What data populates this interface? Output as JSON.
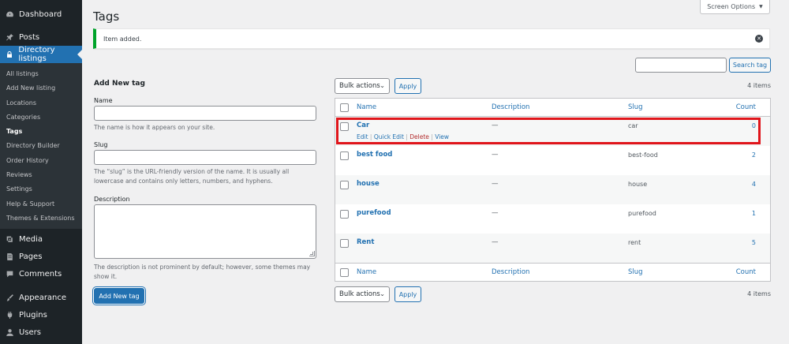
{
  "sidebar": {
    "top_items": [
      {
        "label": "Dashboard",
        "icon": "dashboard-icon"
      },
      {
        "label": "Posts",
        "icon": "pin-icon"
      },
      {
        "label": "Directory listings",
        "icon": "lock-icon"
      }
    ],
    "submenu": [
      "All listings",
      "Add New listing",
      "Locations",
      "Categories",
      "Tags",
      "Directory Builder",
      "Order History",
      "Reviews",
      "Settings",
      "Help & Support",
      "Themes & Extensions"
    ],
    "bottom_items": [
      {
        "label": "Media",
        "icon": "media-icon"
      },
      {
        "label": "Pages",
        "icon": "pages-icon"
      },
      {
        "label": "Comments",
        "icon": "comment-icon"
      },
      {
        "label": "Appearance",
        "icon": "brush-icon"
      },
      {
        "label": "Plugins",
        "icon": "plug-icon"
      },
      {
        "label": "Users",
        "icon": "user-icon"
      }
    ],
    "active_top": "Directory listings",
    "active_sub": "Tags"
  },
  "page": {
    "title": "Tags",
    "screen_options": "Screen Options"
  },
  "notice": {
    "text": "Item added."
  },
  "search": {
    "value": "",
    "button": "Search tag"
  },
  "form": {
    "title": "Add New tag",
    "name_label": "Name",
    "name_value": "",
    "name_help": "The name is how it appears on your site.",
    "slug_label": "Slug",
    "slug_value": "",
    "slug_help": "The “slug” is the URL-friendly version of the name. It is usually all lowercase and contains only letters, numbers, and hyphens.",
    "desc_label": "Description",
    "desc_value": "",
    "desc_help": "The description is not prominent by default; however, some themes may show it.",
    "submit": "Add New tag"
  },
  "table": {
    "bulk_actions": "Bulk actions",
    "apply": "Apply",
    "items_count": "4 items",
    "columns": {
      "name": "Name",
      "description": "Description",
      "slug": "Slug",
      "count": "Count"
    },
    "rows": [
      {
        "name": "Car",
        "description": "—",
        "slug": "car",
        "count": "0"
      },
      {
        "name": "best food",
        "description": "—",
        "slug": "best-food",
        "count": "2"
      },
      {
        "name": "house",
        "description": "—",
        "slug": "house",
        "count": "4"
      },
      {
        "name": "purefood",
        "description": "—",
        "slug": "purefood",
        "count": "1"
      },
      {
        "name": "Rent",
        "description": "—",
        "slug": "rent",
        "count": "5"
      }
    ],
    "row_actions": {
      "edit": "Edit",
      "quick_edit": "Quick Edit",
      "delete": "Delete",
      "view": "View",
      "separator": "|"
    }
  },
  "colors": {
    "sidebar_bg": "#1d2327",
    "accent": "#2271b1",
    "notice_success": "#00a32a",
    "delete": "#b32d2e",
    "highlight": "#e0151b"
  }
}
